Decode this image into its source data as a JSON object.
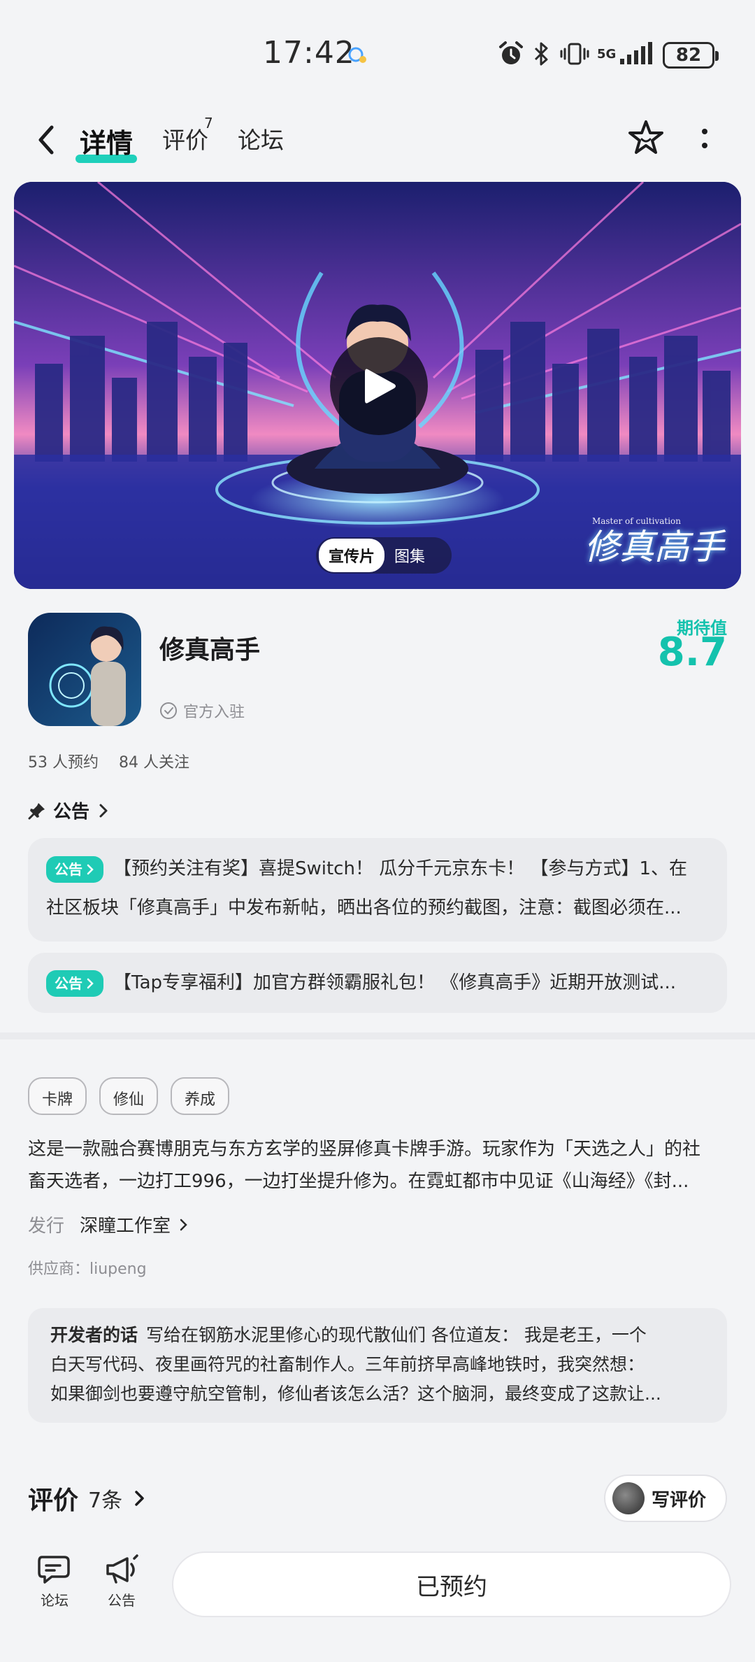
{
  "status_bar": {
    "time": "17:42",
    "network": "5G",
    "battery": "82"
  },
  "nav": {
    "tabs": [
      {
        "label": "详情",
        "active": true
      },
      {
        "label": "评价",
        "badge": "7"
      },
      {
        "label": "论坛"
      }
    ],
    "icons": [
      "back-icon",
      "star-icon",
      "more-icon"
    ]
  },
  "hero": {
    "tabs": [
      {
        "label": "宣传片",
        "active": true
      },
      {
        "label": "图集"
      }
    ],
    "logo_text": "修真高手",
    "logo_subtext": "Master of cultivation"
  },
  "game": {
    "title": "修真高手",
    "official": "官方入驻",
    "rating_label": "期待值",
    "rating_value": "8.7",
    "reservations": "53 人预约",
    "followers": "84 人关注"
  },
  "announcements": {
    "header": "公告",
    "badge": "公告",
    "items": [
      {
        "line1": "【预约关注有奖】喜提Switch！ 瓜分千元京东卡！ 【参与方式】1、在",
        "line2": "社区板块「修真高手」中发布新帖，晒出各位的预约截图，注意：截图必须在..."
      },
      {
        "line1": "【Tap专享福利】加官方群领霸服礼包！ 《修真高手》近期开放测试..."
      }
    ]
  },
  "tags": [
    "卡牌",
    "修仙",
    "养成"
  ],
  "description": {
    "line1": "这是一款融合赛博朋克与东方玄学的竖屏修真卡牌手游。玩家作为「天选之人」的社",
    "line2": "畜天选者，一边打工996，一边打坐提升修为。在霓虹都市中见证《山海经》《封..."
  },
  "publisher": {
    "label": "发行",
    "name": "深瞳工作室"
  },
  "supplier": "供应商：liupeng",
  "developer_note": {
    "label": "开发者的话",
    "line1": "写给在钢筋水泥里修心的现代散仙们 各位道友：  我是老王，一个",
    "line2": "白天写代码、夜里画符咒的社畜制作人。三年前挤早高峰地铁时，我突然想：",
    "line3": "如果御剑也要遵守航空管制，修仙者该怎么活？这个脑洞，最终变成了这款让..."
  },
  "reviews": {
    "title": "评价",
    "count": "7条",
    "write_label": "写评价"
  },
  "bottom_bar": {
    "forum_label": "论坛",
    "announcement_label": "公告",
    "reserved_label": "已预约"
  },
  "colors": {
    "accent": "#1fcbb5",
    "rating": "#14c2ad",
    "background": "#f3f4f6"
  }
}
